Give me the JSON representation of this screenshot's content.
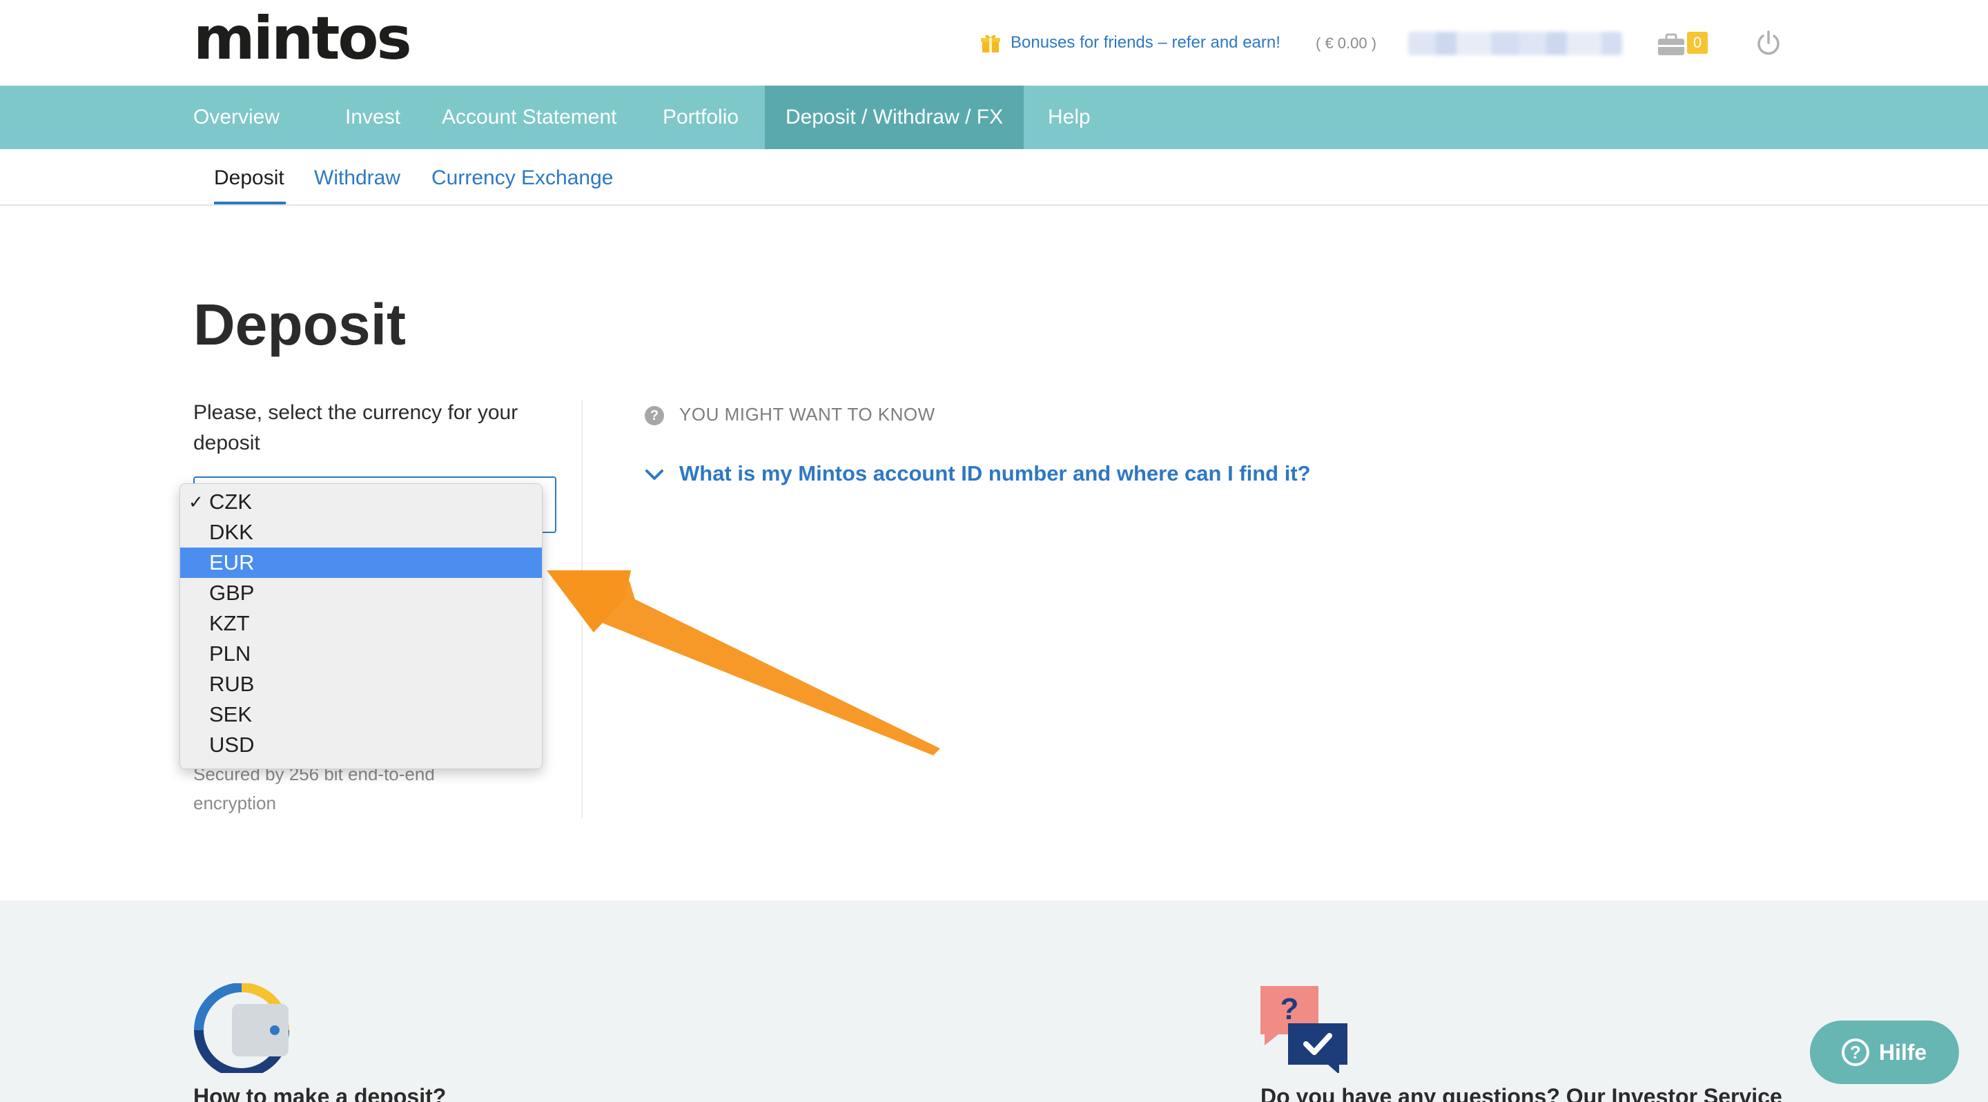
{
  "header": {
    "logo": "mintos",
    "bonus_link": "Bonuses for friends – refer and earn!",
    "balance": "( € 0.00 )",
    "notification_count": "0"
  },
  "main_nav": {
    "items": [
      {
        "label": "Overview"
      },
      {
        "label": "Invest"
      },
      {
        "label": "Account Statement"
      },
      {
        "label": "Portfolio"
      },
      {
        "label": "Deposit / Withdraw / FX",
        "active": true
      },
      {
        "label": "Help"
      }
    ]
  },
  "sub_nav": {
    "tabs": [
      {
        "label": "Deposit",
        "active": true
      },
      {
        "label": "Withdraw"
      },
      {
        "label": "Currency Exchange"
      }
    ]
  },
  "main": {
    "title": "Deposit",
    "select_label": "Please, select the currency for your deposit",
    "secured_text": "Secured by 256 bit end-to-end encryption"
  },
  "currency_dropdown": {
    "checked_value": "CZK",
    "highlighted_value": "EUR",
    "options": [
      "CZK",
      "DKK",
      "EUR",
      "GBP",
      "KZT",
      "PLN",
      "RUB",
      "SEK",
      "USD"
    ]
  },
  "info_panel": {
    "header": "YOU MIGHT WANT TO KNOW",
    "faq_question": "What is my Mintos account ID number and where can I find it?"
  },
  "footer": {
    "left_heading": "How to make a deposit?",
    "right_heading": "Do you have any questions? Our Investor Service"
  },
  "help_button": {
    "label": "Hilfe"
  },
  "colors": {
    "nav_bg": "#7ec8c9",
    "nav_active_bg": "#5aaaad",
    "link_blue": "#2e78c4",
    "highlight_blue": "#4b8ef0",
    "annotation_arrow": "#f7941d",
    "footer_bg": "#eff3f4"
  }
}
